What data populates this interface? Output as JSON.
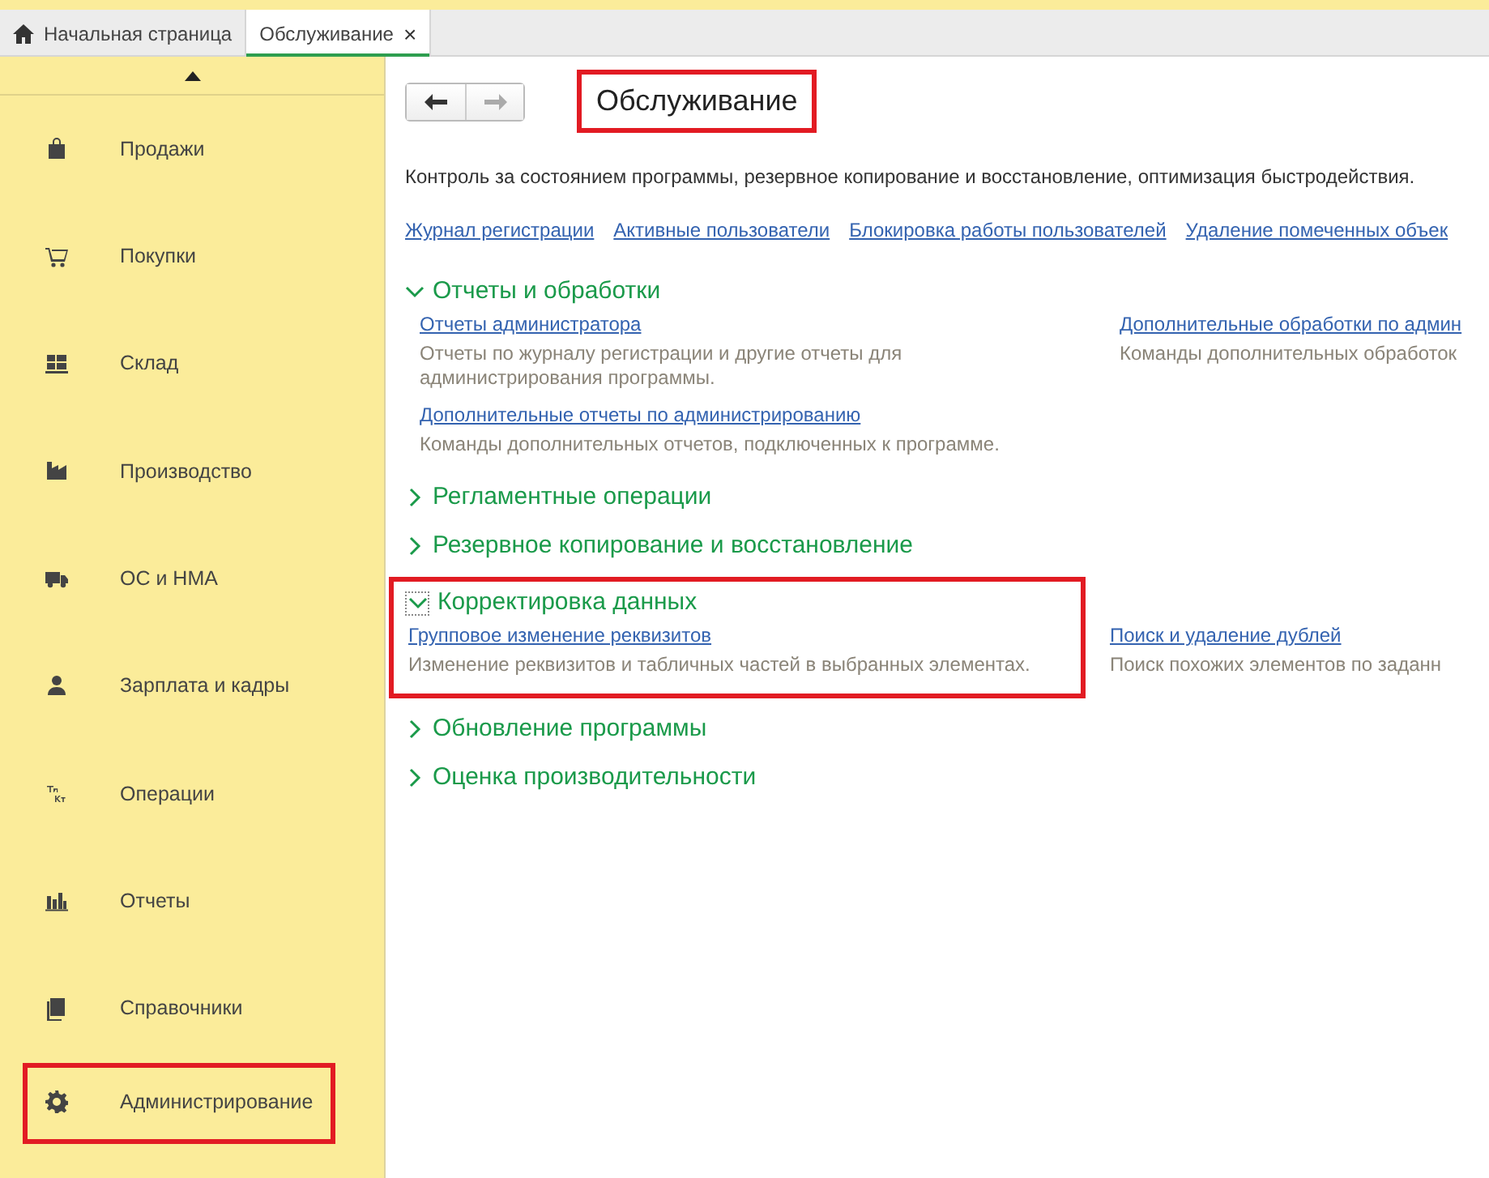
{
  "tabs": [
    {
      "label": "Начальная страница",
      "selected": false
    },
    {
      "label": "Обслуживание",
      "selected": true,
      "close": "×"
    }
  ],
  "sidebar": {
    "items": [
      {
        "label": "Продажи",
        "highlighted": false
      },
      {
        "label": "Покупки",
        "highlighted": false
      },
      {
        "label": "Склад",
        "highlighted": false
      },
      {
        "label": "Производство",
        "highlighted": false
      },
      {
        "label": "ОС и НМА",
        "highlighted": false
      },
      {
        "label": "Зарплата и кадры",
        "highlighted": false
      },
      {
        "label": "Операции",
        "highlighted": false
      },
      {
        "label": "Отчеты",
        "highlighted": false
      },
      {
        "label": "Справочники",
        "highlighted": false
      },
      {
        "label": "Администрирование",
        "highlighted": true
      }
    ]
  },
  "page": {
    "title": "Обслуживание",
    "title_highlighted": true,
    "description": "Контроль за состоянием программы, резервное копирование и восстановление, оптимизация быстродействия.",
    "links": [
      "Журнал регистрации",
      "Активные пользователи",
      "Блокировка работы пользователей",
      "Удаление помеченных объек"
    ],
    "sections": [
      {
        "title": "Отчеты и обработки",
        "expanded": true,
        "highlighted": false,
        "columns": [
          [
            {
              "link": "Отчеты администратора",
              "description": "Отчеты по журналу регистрации и другие отчеты для администрирования программы."
            },
            {
              "link": "Дополнительные отчеты по администрированию",
              "description": "Команды дополнительных отчетов, подключенных к программе."
            }
          ],
          [
            {
              "link": "Дополнительные обработки по админ",
              "description": "Команды дополнительных обработок"
            }
          ]
        ]
      },
      {
        "title": "Регламентные операции",
        "expanded": false,
        "highlighted": false
      },
      {
        "title": "Резервное копирование и восстановление",
        "expanded": false,
        "highlighted": false
      },
      {
        "title": "Корректировка данных",
        "expanded": true,
        "highlighted": true,
        "columns": [
          [
            {
              "link": "Групповое изменение реквизитов",
              "description": "Изменение реквизитов и табличных частей в выбранных элементах."
            }
          ],
          [
            {
              "link": "Поиск и удаление дублей",
              "description": "Поиск похожих элементов по заданн"
            }
          ]
        ]
      },
      {
        "title": "Обновление программы",
        "expanded": false,
        "highlighted": false
      },
      {
        "title": "Оценка производительности",
        "expanded": false,
        "highlighted": false
      }
    ]
  }
}
